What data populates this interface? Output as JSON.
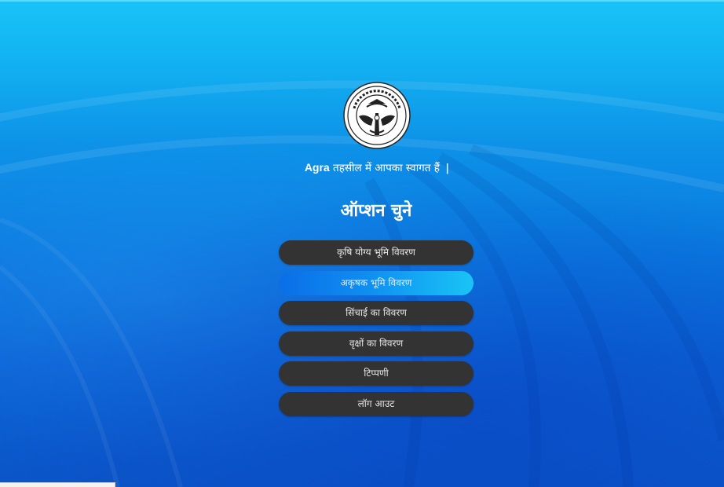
{
  "welcome": {
    "city": "Agra",
    "text": "तहसील में आपका स्वागत हैं",
    "separator": "|"
  },
  "emblem": {
    "name": "up-government-emblem",
    "text": "उत्तर प्रदेश सरकार"
  },
  "heading": "ऑप्शन चुने",
  "menu": {
    "items": [
      {
        "label": "कृषि योग्य भूमि विवरण",
        "active": false
      },
      {
        "label": "अकृषक भूमि विवरण",
        "active": true
      },
      {
        "label": "सिंचाई का विवरण",
        "active": false
      },
      {
        "label": "वृक्षों का विवरण",
        "active": false
      },
      {
        "label": "टिप्पणी",
        "active": false
      },
      {
        "label": "लॉग आउट",
        "active": false
      }
    ]
  },
  "colors": {
    "background_top": "#18c3f6",
    "background_bottom": "#0a55c8",
    "button": "#333333",
    "button_active_start": "#0b6ee8",
    "button_active_end": "#19c4f6"
  }
}
